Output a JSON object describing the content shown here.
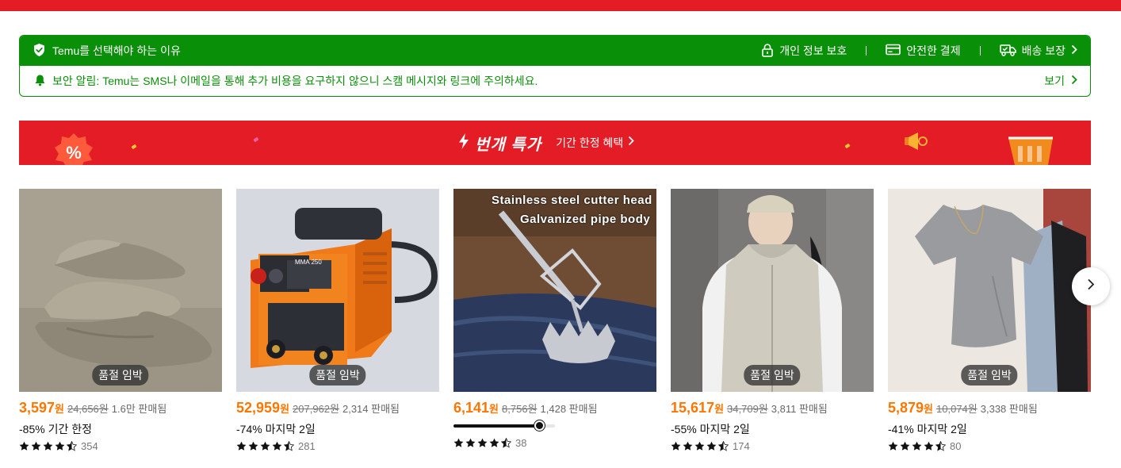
{
  "trust": {
    "why_label": "Temu를 선택해야 하는 이유",
    "features": [
      "개인 정보 보호",
      "안전한 결제",
      "배송 보장"
    ],
    "alert": "보안 알림: Temu는 SMS나 이메일을 통해 추가 비용을 요구하지 않으니 스캠 메시지와 링크에 주의하세요.",
    "view_label": "보기"
  },
  "deal": {
    "title": "번개 특가",
    "subtitle": "기간 한정 혜택"
  },
  "colors": {
    "brand_red": "#e31c25",
    "trust_green": "#0a8f08",
    "price_orange": "#fb7701"
  },
  "products": [
    {
      "badge": "품절 임박",
      "price": "3,597",
      "currency": "원",
      "old_price": "24,656원",
      "sold": "1.6만 판매됨",
      "promo": "-85% 기간 한정",
      "rating": 4.5,
      "reviews": "354"
    },
    {
      "badge": "품절 임박",
      "price": "52,959",
      "currency": "원",
      "old_price": "207,962원",
      "sold": "2,314 판매됨",
      "promo": "-74% 마지막 2일",
      "rating": 4.5,
      "reviews": "281"
    },
    {
      "badge": "",
      "price": "6,141",
      "currency": "원",
      "old_price": "8,756원",
      "sold": "1,428 판매됨",
      "promo": "",
      "progress": 0.84,
      "image_text": [
        "Stainless steel cutter head",
        "Galvanized pipe body"
      ],
      "rating": 4.5,
      "reviews": "38"
    },
    {
      "badge": "품절 임박",
      "price": "15,617",
      "currency": "원",
      "old_price": "34,709원",
      "sold": "3,811 판매됨",
      "promo": "-55% 마지막 2일",
      "rating": 4.5,
      "reviews": "174"
    },
    {
      "badge": "품절 임박",
      "price": "5,879",
      "currency": "원",
      "old_price": "10,074원",
      "sold": "3,338 판매됨",
      "promo": "-41% 마지막 2일",
      "rating": 4.5,
      "reviews": "80"
    }
  ],
  "icons": {
    "shield": "shield-check-icon",
    "lock": "lock-icon",
    "card": "credit-card-icon",
    "truck": "delivery-truck-icon",
    "bell": "bell-icon",
    "chevron": "chevron-right-icon",
    "lightning": "lightning-icon"
  }
}
